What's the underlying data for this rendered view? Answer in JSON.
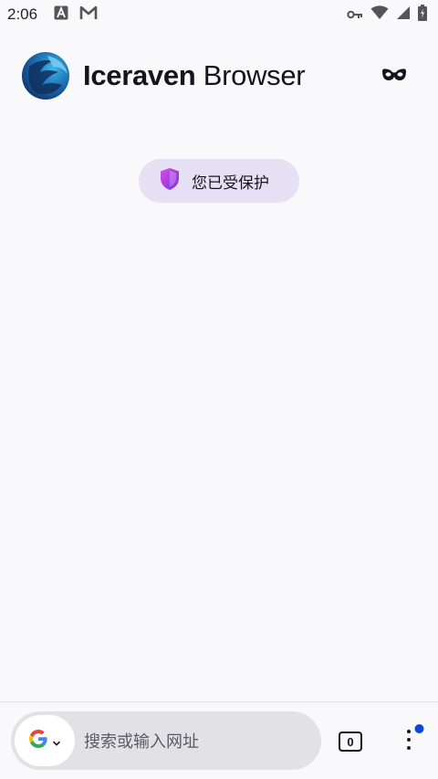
{
  "status_bar": {
    "time": "2:06",
    "left_icons": [
      "a-notification-icon",
      "gmail-icon"
    ],
    "right_icons": [
      "key-icon",
      "wifi-icon",
      "signal-icon",
      "battery-icon"
    ]
  },
  "header": {
    "title_bold": "Iceraven",
    "title_light": " Browser",
    "logo_icon": "iceraven-logo-icon",
    "private_icon": "private-mask-icon"
  },
  "protection": {
    "label": "您已受保护",
    "icon": "shield-icon"
  },
  "toolbar": {
    "search_placeholder": "搜索或输入网址",
    "engine_icon": "google-g-icon",
    "tab_count": "0",
    "menu_icon": "more-vertical-icon"
  },
  "colors": {
    "background": "#f9f9fb",
    "pill": "#e6e0f5",
    "url_bar": "#e2e1e6",
    "menu_badge": "#0b48d8"
  }
}
